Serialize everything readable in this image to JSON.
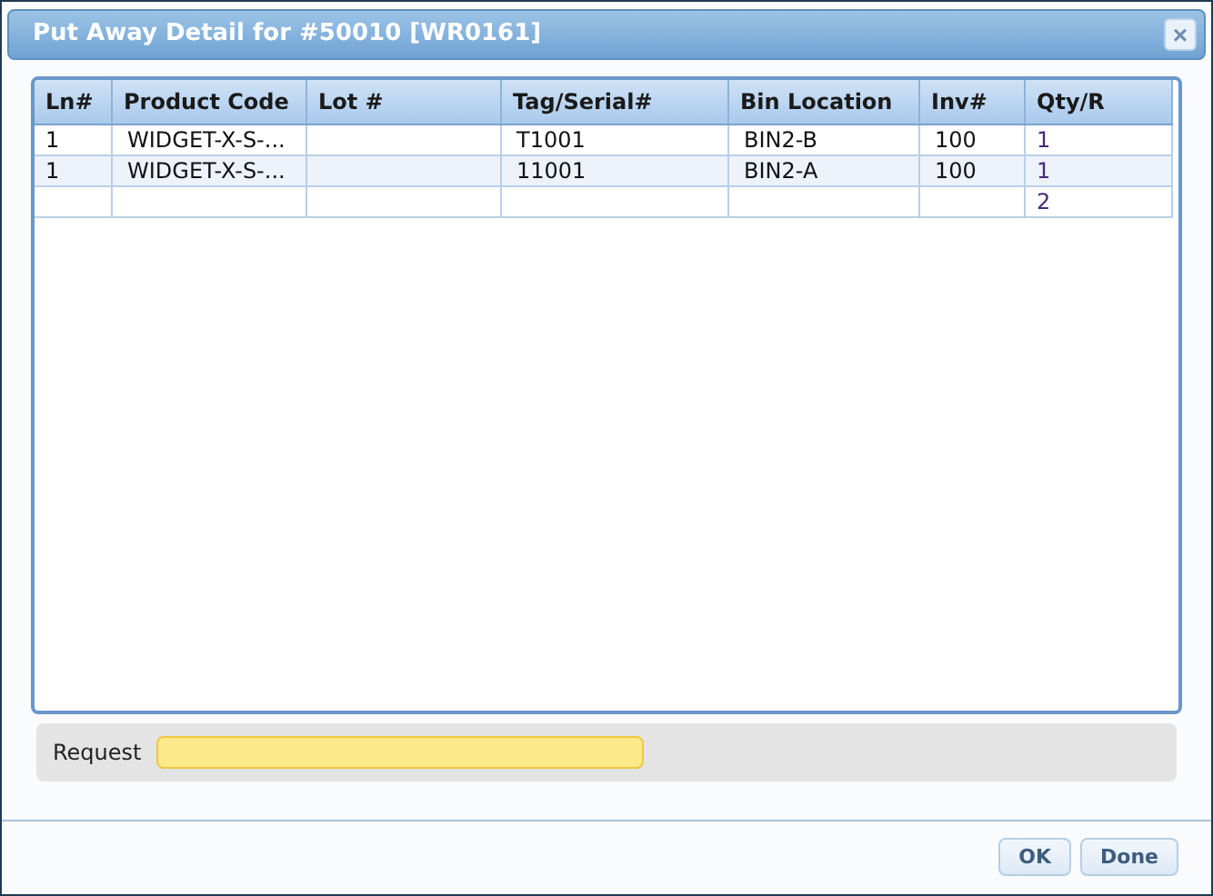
{
  "window": {
    "title": "Put Away Detail for #50010 [WR0161]",
    "close_icon": "×"
  },
  "table": {
    "columns": [
      "Ln#",
      "Product Code",
      "Lot #",
      "Tag/Serial#",
      "Bin Location",
      "Inv#",
      "Qty/R"
    ],
    "rows": [
      {
        "cells": [
          "1",
          "WIDGET-X-S-...",
          null,
          "T1001",
          "BIN2-B",
          "100",
          "1"
        ]
      },
      {
        "cells": [
          "1",
          "WIDGET-X-S-...",
          null,
          "11001",
          "BIN2-A",
          "100",
          "1"
        ]
      }
    ],
    "total_row": {
      "qty_r": "2"
    }
  },
  "request": {
    "label": "Request"
  },
  "buttons": [
    "OK",
    "Done"
  ]
}
